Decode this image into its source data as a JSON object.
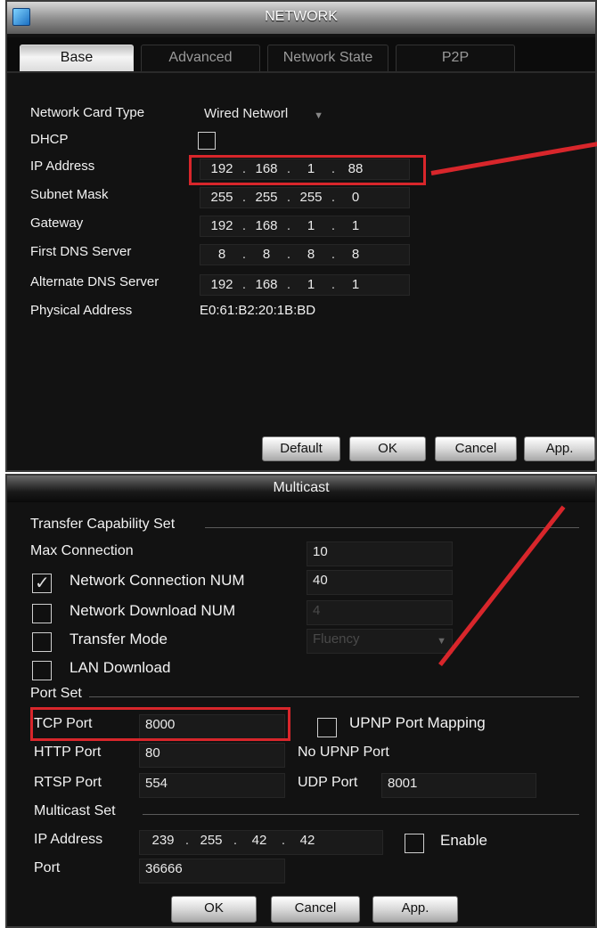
{
  "window": {
    "title": "NETWORK"
  },
  "tabs": [
    {
      "label": "Base",
      "active": true
    },
    {
      "label": "Advanced",
      "active": false
    },
    {
      "label": "Network State",
      "active": false
    },
    {
      "label": "P2P",
      "active": false
    }
  ],
  "base": {
    "network_card_type": {
      "label": "Network Card Type",
      "value": "Wired Networl"
    },
    "dhcp": {
      "label": "DHCP",
      "checked": false
    },
    "ip_address": {
      "label": "IP Address",
      "octets": [
        "192",
        "168",
        "1",
        "88"
      ]
    },
    "subnet_mask": {
      "label": "Subnet Mask",
      "octets": [
        "255",
        "255",
        "255",
        "0"
      ]
    },
    "gateway": {
      "label": "Gateway",
      "octets": [
        "192",
        "168",
        "1",
        "1"
      ]
    },
    "first_dns": {
      "label": "First DNS Server",
      "octets": [
        "8",
        "8",
        "8",
        "8"
      ]
    },
    "alternate_dns": {
      "label": "Alternate DNS Server",
      "octets": [
        "192",
        "168",
        "1",
        "1"
      ]
    },
    "physical_address": {
      "label": "Physical Address",
      "value": "E0:61:B2:20:1B:BD"
    }
  },
  "top_buttons": {
    "default": "Default",
    "ok": "OK",
    "cancel": "Cancel",
    "apply": "App."
  },
  "multicast": {
    "title": "Multicast",
    "transfer_section": "Transfer Capability Set",
    "max_connection": {
      "label": "Max Connection",
      "value": "10"
    },
    "network_connection_num": {
      "label": "Network Connection NUM",
      "value": "40",
      "checked": true
    },
    "network_download_num": {
      "label": "Network Download NUM",
      "value": "4",
      "checked": false
    },
    "transfer_mode": {
      "label": "Transfer Mode",
      "value": "Fluency",
      "checked": false
    },
    "lan_download": {
      "label": "LAN Download",
      "checked": false
    },
    "port_section": "Port Set",
    "tcp_port": {
      "label": "TCP Port",
      "value": "8000"
    },
    "upnp_mapping": {
      "label": "UPNP Port Mapping",
      "checked": false
    },
    "http_port": {
      "label": "HTTP Port",
      "value": "80"
    },
    "no_upnp_port": "No UPNP Port",
    "rtsp_port": {
      "label": "RTSP Port",
      "value": "554"
    },
    "udp_port": {
      "label": "UDP Port",
      "value": "8001"
    },
    "multicast_section": "Multicast Set",
    "mc_ip_address": {
      "label": "IP Address",
      "octets": [
        "239",
        "255",
        "42",
        "42"
      ]
    },
    "mc_enable": {
      "label": "Enable",
      "checked": false
    },
    "mc_port": {
      "label": "Port",
      "value": "36666"
    }
  },
  "bottom_buttons": {
    "ok": "OK",
    "cancel": "Cancel",
    "apply": "App."
  },
  "colors": {
    "highlight": "#d8262b",
    "panel_bg": "#121212"
  }
}
